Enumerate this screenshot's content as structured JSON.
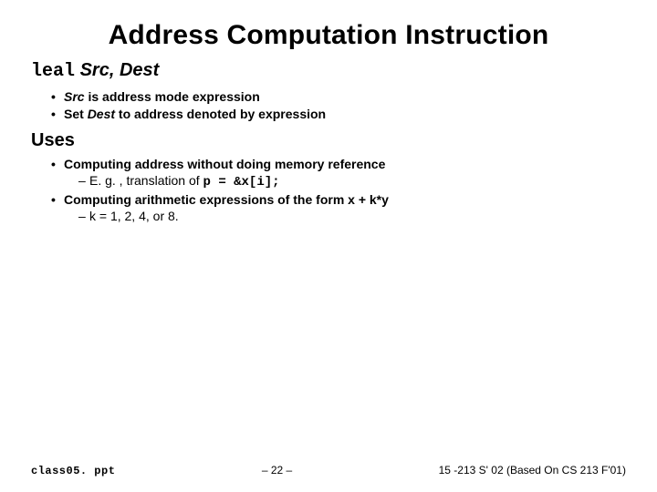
{
  "title": "Address Computation Instruction",
  "sect1": {
    "instr": "leal",
    "args": "Src, Dest"
  },
  "b1": {
    "a": "Src",
    "a_rest": " is address mode expression",
    "b_pre": "Set ",
    "b_mid": "Dest",
    "b_rest": " to address denoted by expression"
  },
  "uses_label": "Uses",
  "b2": {
    "a": "Computing address without doing memory reference",
    "a_sub_pre": "E. g. , translation of ",
    "a_sub_code": "p = &x[i];",
    "b": "Computing arithmetic expressions of the form x + k*y",
    "b_sub": "k = 1, 2, 4, or 8."
  },
  "footer": {
    "filename": "class05. ppt",
    "pagenum": "– 22 –",
    "course": "15 -213 S' 02 (Based On CS 213 F'01)"
  }
}
